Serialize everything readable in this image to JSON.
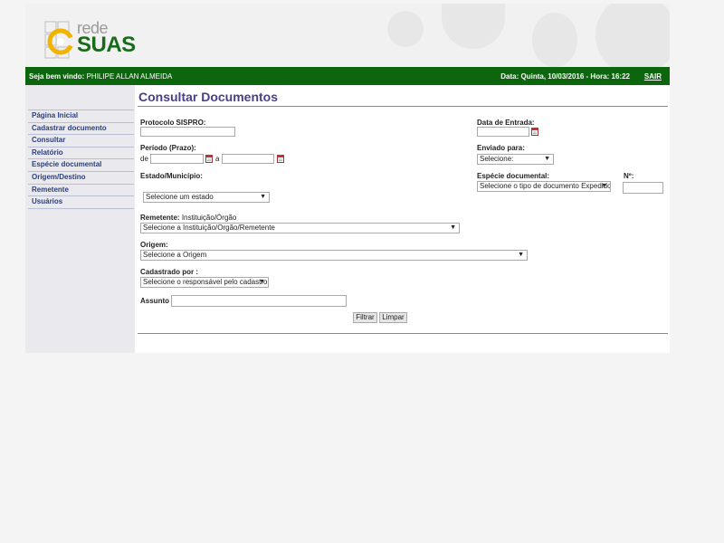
{
  "header": {
    "logo_rede": "rede",
    "logo_suas": "SUAS"
  },
  "welcome_bar": {
    "welcome_label": "Seja bem vindo:",
    "user_name": "PHILIPE ALLAN ALMEIDA",
    "date_text": "Data: Quinta, 10/03/2016 - Hora: 16:22",
    "logout": "SAIR"
  },
  "sidebar": {
    "items": [
      {
        "label": "Página Inicial"
      },
      {
        "label": "Cadastrar documento"
      },
      {
        "label": "Consultar"
      },
      {
        "label": "Relatório"
      },
      {
        "label": "Espécie documental"
      },
      {
        "label": "Origem/Destino"
      },
      {
        "label": "Remetente"
      },
      {
        "label": "Usuários"
      }
    ]
  },
  "main": {
    "title": "Consultar Documentos"
  },
  "form": {
    "protocolo_label": "Protocolo SISPRO:",
    "data_entrada_label": "Data de Entrada:",
    "periodo_label": "Período (Prazo):",
    "de_label": "de",
    "a_label": "a",
    "enviado_label": "Enviado para:",
    "enviado_value": "Selecione:",
    "estado_label": "Estado/Município:",
    "estado_value": "Selecione um estado",
    "especie_label": "Espécie documental:",
    "especie_value": "Selecione o tipo de documento Expedido",
    "numero_label": "Nº:",
    "remetente_label": "Remetente:",
    "remetente_hint": "Instituição/Órgão",
    "remetente_value": "Selecione a Instituição/Orgão/Remetente",
    "origem_label": "Origem:",
    "origem_value": "Selecione a Origem",
    "cadastrado_label": "Cadastrado por :",
    "cadastrado_value": "Selecione o responsável pelo cadastro",
    "assunto_label": "Assunto :",
    "filtrar": "Filtrar",
    "limpar": "Limpar"
  },
  "colors": {
    "green_bar": "#0d650d",
    "title_purple": "#4a3f86",
    "menu_blue": "#2c3f7a"
  },
  "icons": [
    "calendar-icon",
    "dropdown-arrow-icon"
  ]
}
